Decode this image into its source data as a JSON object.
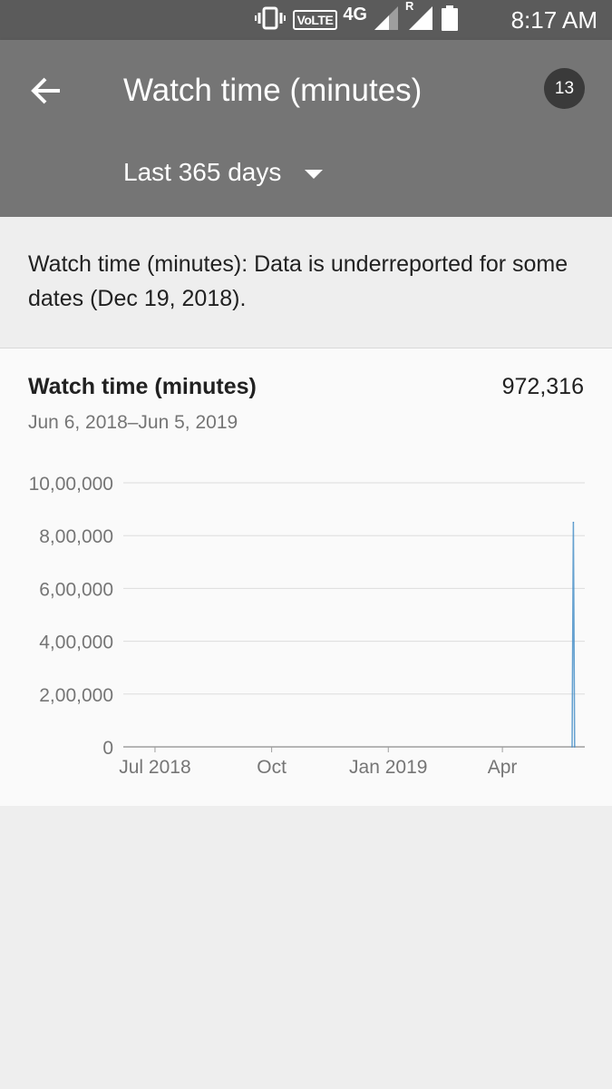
{
  "status_bar": {
    "time": "8:17 AM",
    "volte": "VoLTE",
    "network": "4G",
    "roaming": "R",
    "icons": [
      "vibrate-icon",
      "volte-icon",
      "signal-icon",
      "signal-roaming-icon",
      "battery-icon"
    ]
  },
  "app_bar": {
    "title": "Watch time (minutes)",
    "notification_count": "13",
    "range_label": "Last 365 days",
    "back_icon": "arrow-back-icon",
    "dropdown_icon": "caret-down-icon"
  },
  "notice": {
    "text": "Watch time (minutes): Data is underreported for some dates (Dec 19, 2018)."
  },
  "metric": {
    "title": "Watch time (minutes)",
    "value": "972,316",
    "date_range": "Jun 6, 2018–Jun 5, 2019"
  },
  "colors": {
    "status_bar": "#5b5b5b",
    "app_bar": "#757575",
    "badge": "#3a3a3a",
    "series": "#4a90c8"
  },
  "chart_data": {
    "type": "line",
    "x_start": "2018-06-06",
    "x_end": "2019-06-05",
    "ylim": [
      0,
      1000000
    ],
    "y_ticks": [
      0,
      200000,
      400000,
      600000,
      800000,
      1000000
    ],
    "y_tick_labels": [
      "0",
      "2,00,000",
      "4,00,000",
      "6,00,000",
      "8,00,000",
      "10,00,000"
    ],
    "x_ticks": [
      {
        "date": "2018-07-01",
        "label": "Jul 2018"
      },
      {
        "date": "2018-10-01",
        "label": "Oct"
      },
      {
        "date": "2019-01-01",
        "label": "Jan 2019"
      },
      {
        "date": "2019-04-01",
        "label": "Apr"
      }
    ],
    "grid": true,
    "series": [
      {
        "points": [
          {
            "x": "2019-05-26",
            "y": 0
          },
          {
            "x": "2019-05-27",
            "y": 850000
          },
          {
            "x": "2019-05-28",
            "y": 0
          }
        ]
      }
    ]
  }
}
